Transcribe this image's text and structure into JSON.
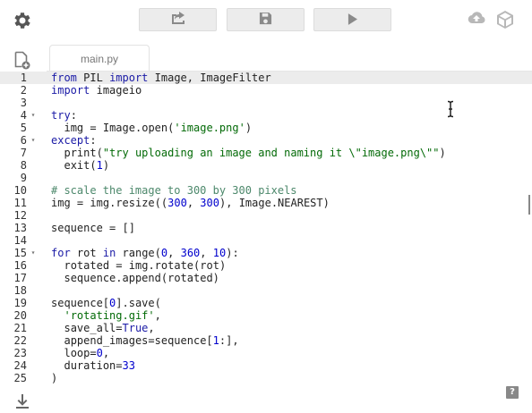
{
  "toolbar": {
    "settings_icon": "gear-icon",
    "share_icon": "share-icon",
    "save_icon": "floppy-disk-icon",
    "run_icon": "play-icon",
    "cloud_icon": "cloud-upload-icon",
    "package_icon": "cube-icon"
  },
  "sidebar": {
    "new_file_icon": "new-file-icon",
    "download_icon": "download-icon"
  },
  "tabs": [
    {
      "label": "main.py",
      "active": true
    }
  ],
  "editor": {
    "active_line": 1,
    "lines": [
      {
        "n": "1",
        "fold": false,
        "text": "from PIL import Image, ImageFilter"
      },
      {
        "n": "2",
        "fold": false,
        "text": "import imageio"
      },
      {
        "n": "3",
        "fold": false,
        "text": ""
      },
      {
        "n": "4",
        "fold": true,
        "text": "try:"
      },
      {
        "n": "5",
        "fold": false,
        "text": "  img = Image.open('image.png')"
      },
      {
        "n": "6",
        "fold": true,
        "text": "except:"
      },
      {
        "n": "7",
        "fold": false,
        "text": "  print(\"try uploading an image and naming it \\\"image.png\\\"\")"
      },
      {
        "n": "8",
        "fold": false,
        "text": "  exit(1)"
      },
      {
        "n": "9",
        "fold": false,
        "text": ""
      },
      {
        "n": "10",
        "fold": false,
        "text": "# scale the image to 300 by 300 pixels"
      },
      {
        "n": "11",
        "fold": false,
        "text": "img = img.resize((300, 300), Image.NEAREST)"
      },
      {
        "n": "12",
        "fold": false,
        "text": ""
      },
      {
        "n": "13",
        "fold": false,
        "text": "sequence = []"
      },
      {
        "n": "14",
        "fold": false,
        "text": ""
      },
      {
        "n": "15",
        "fold": true,
        "text": "for rot in range(0, 360, 10):"
      },
      {
        "n": "16",
        "fold": false,
        "text": "  rotated = img.rotate(rot)"
      },
      {
        "n": "17",
        "fold": false,
        "text": "  sequence.append(rotated)"
      },
      {
        "n": "18",
        "fold": false,
        "text": ""
      },
      {
        "n": "19",
        "fold": false,
        "text": "sequence[0].save("
      },
      {
        "n": "20",
        "fold": false,
        "text": "  'rotating.gif',"
      },
      {
        "n": "21",
        "fold": false,
        "text": "  save_all=True,"
      },
      {
        "n": "22",
        "fold": false,
        "text": "  append_images=sequence[1:],"
      },
      {
        "n": "23",
        "fold": false,
        "text": "  loop=0,"
      },
      {
        "n": "24",
        "fold": false,
        "text": "  duration=33"
      },
      {
        "n": "25",
        "fold": false,
        "text": ")"
      }
    ]
  },
  "help": {
    "label": "?"
  },
  "colors": {
    "keyword": "#1a1aa6",
    "string": "#036a07",
    "number": "#0000cd",
    "comment": "#4c886b",
    "active_line": "#ececec"
  }
}
